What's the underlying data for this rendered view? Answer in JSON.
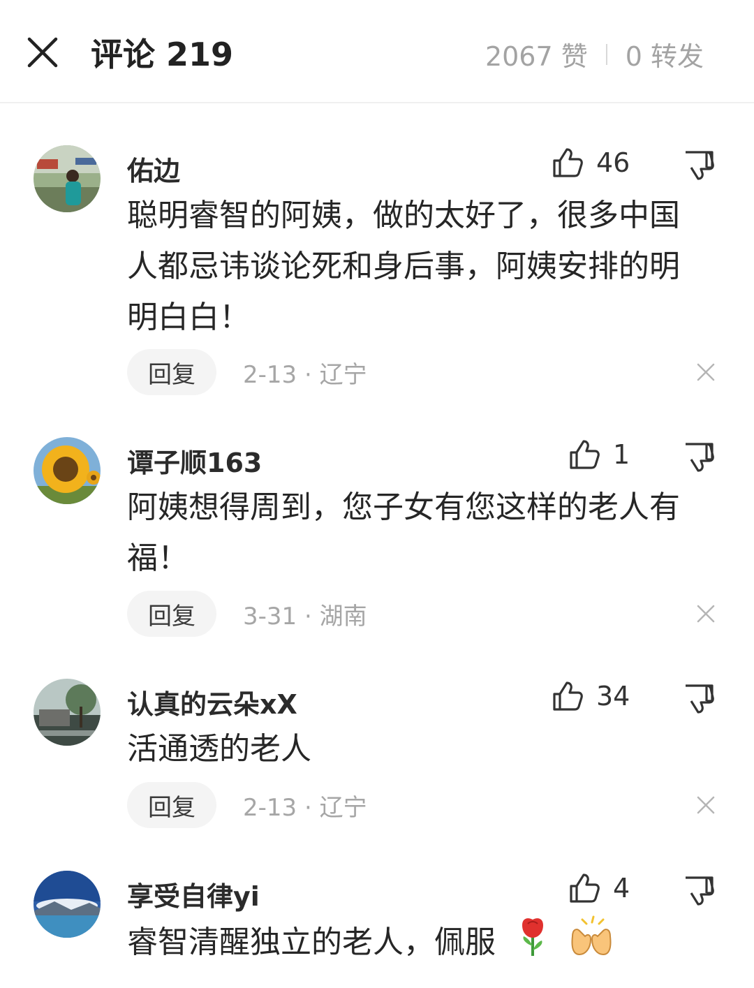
{
  "header": {
    "title": "评论 219",
    "likes": "2067 赞",
    "shares": "0 转发"
  },
  "comments": [
    {
      "username": "佑边",
      "likes": "46",
      "text": "聪明睿智的阿姨，做的太好了，很多中国人都忌讳谈论死和身后事，阿姨安排的明明白白！",
      "reply": "回复",
      "meta": "2-13 · 辽宁"
    },
    {
      "username": "谭子顺163",
      "likes": "1",
      "text": "阿姨想得周到，您子女有您这样的老人有福！",
      "reply": "回复",
      "meta": "3-31 · 湖南"
    },
    {
      "username": "认真的云朵xX",
      "likes": "34",
      "text": "活通透的老人",
      "reply": "回复",
      "meta": "2-13 · 辽宁"
    },
    {
      "username": "享受自律yi",
      "likes": "4",
      "text": "睿智清醒独立的老人，佩服",
      "emojis": [
        "rose-emoji",
        "clapping-hands-emoji"
      ]
    }
  ],
  "icons": {
    "close": "close-icon",
    "like": "thumbs-up-icon",
    "dislike": "thumbs-down-icon",
    "dismiss": "dismiss-x-icon"
  },
  "colors": {
    "muted_text": "#a6a6a6",
    "reply_bg": "#f4f4f4"
  }
}
